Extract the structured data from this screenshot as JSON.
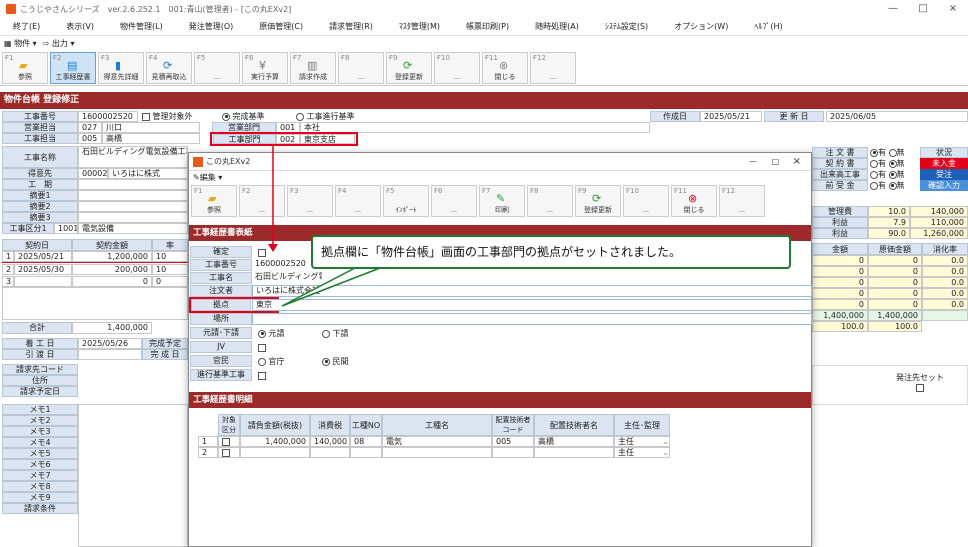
{
  "window": {
    "title": "こうじやさんシリーズ　ver.2.6.252.1　001:青山(管理者) - [この丸EXv2]",
    "minimize": "—",
    "maximize": "□",
    "close": "×"
  },
  "menu": [
    "終了(E)",
    "表示(V)",
    "物件管理(L)",
    "発注管理(O)",
    "原価管理(C)",
    "請求管理(R)",
    "ﾏｽﾀ管理(M)",
    "帳票印刷(P)",
    "随時処理(A)",
    "ｼｽﾃﾑ設定(S)",
    "オプション(W)",
    "ﾍﾙﾌﾟ(H)"
  ],
  "subbar": {
    "item1": "物件",
    "item2": "出力"
  },
  "fkeys": [
    {
      "key": "F1",
      "label": "参照",
      "icon": "folder-icon"
    },
    {
      "key": "F2",
      "label": "工事経歴書",
      "icon": "document-icon"
    },
    {
      "key": "F3",
      "label": "得意先詳細",
      "icon": "user-icon"
    },
    {
      "key": "F4",
      "label": "見積再取込",
      "icon": "refresh-icon"
    },
    {
      "key": "F5",
      "label": "—",
      "icon": ""
    },
    {
      "key": "F6",
      "label": "実行予算",
      "icon": "yen-icon"
    },
    {
      "key": "F7",
      "label": "請求作成",
      "icon": "doc-icon"
    },
    {
      "key": "F8",
      "label": "—",
      "icon": ""
    },
    {
      "key": "F9",
      "label": "登録更新",
      "icon": "refresh-icon"
    },
    {
      "key": "F10",
      "label": "—",
      "icon": ""
    },
    {
      "key": "F11",
      "label": "閉じる",
      "icon": "close-icon"
    },
    {
      "key": "F12",
      "label": "—",
      "icon": ""
    }
  ],
  "section": {
    "title": "物件台帳 登録修正"
  },
  "form": {
    "koji_no_label": "工事番号",
    "koji_no": "1600002520",
    "kanri_gai": "管理対象外",
    "kanseikijun": "完成基準",
    "shinkou": "工事進行基準",
    "sakuseibi_label": "作成日",
    "sakuseibi": "2025/05/21",
    "koshinbi_label": "更 新 日",
    "koshinbi": "2025/06/05",
    "eigyo_label": "営業担当",
    "eigyo_code": "027",
    "eigyo_name": "川口",
    "eigyobumon_label": "営業部門",
    "eigyobumon_code": "001",
    "eigyobumon_name": "本社",
    "koji_tanto_label": "工事担当",
    "koji_tanto_code": "005",
    "koji_tanto_name": "高橋",
    "kojibumon_label": "工事部門",
    "kojibumon_code": "002",
    "kojibumon_name": "東京支店",
    "kojimei_label": "工事名称",
    "kojimei": "石田ビルディング電気設備工事",
    "tokuisaki_label": "得意先",
    "tokuisaki_code": "00002",
    "tokuisaki_name": "いろはに株式",
    "kouki_label": "工　期",
    "tekiyo1": "摘要1",
    "tekiyo2": "摘要2",
    "tekiyo3": "摘要3",
    "kojikubun_label": "工事区分1",
    "kojikubun_code": "1001",
    "kojikubun_name": "電気設備"
  },
  "contract": {
    "headers": [
      "契約日",
      "契約金額",
      "率"
    ],
    "rows": [
      [
        "1",
        "2025/05/21",
        "1,200,000",
        "10"
      ],
      [
        "2",
        "2025/05/30",
        "200,000",
        "10"
      ],
      [
        "3",
        "",
        "0",
        "0"
      ]
    ],
    "total_label": "合計",
    "total": "1,400,000"
  },
  "dates": {
    "chakko_label": "着 工 日",
    "chakko": "2025/05/26",
    "kansei_label": "完成予定",
    "hikiwatashi_label": "引 渡 日",
    "kansei2_label": "完 成 日"
  },
  "left_memo": {
    "seikyu_code": "請求先コード",
    "jusho": "住所",
    "seikyu_yotei": "請求予定日",
    "memos": [
      "メモ1",
      "メモ2",
      "メモ3",
      "メモ4",
      "メモ5",
      "メモ6",
      "メモ7",
      "メモ8",
      "メモ9"
    ],
    "joken": "請求条件"
  },
  "right": {
    "chumon_label": "注 文 書",
    "keiyaku_label": "契 約 書",
    "dekidaka_label": "出来高工事",
    "maeukekin_label": "前 受 金",
    "yes": "有",
    "no": "無",
    "jokyo_label": "状況",
    "state1": "未入金",
    "state2": "受注",
    "state3": "確認入力",
    "kanrihi_label": "管理費",
    "kanrihi_rate": "10.0",
    "kanrihi_amt": "140,000",
    "rieki1_label": "利益",
    "rieki1_rate": "7.9",
    "rieki1_amt": "110,000",
    "rieki2_label": "利益",
    "rieki2_rate": "90.0",
    "rieki2_amt": "1,260,000",
    "cost_headers": [
      "金額",
      "原価金額",
      "消化率"
    ],
    "cost_rows": [
      [
        "0",
        "0",
        "0.0"
      ],
      [
        "0",
        "0",
        "0.0"
      ],
      [
        "0",
        "0",
        "0.0"
      ],
      [
        "0",
        "0",
        "0.0"
      ],
      [
        "0",
        "0",
        "0.0"
      ]
    ],
    "cost_total": [
      "1,400,000",
      "1,400,000",
      ""
    ],
    "cost_pct": [
      "100.0",
      "100.0",
      ""
    ],
    "hacchusaki_set": "発注先セット"
  },
  "popup": {
    "title": "この丸EXv2",
    "menu": "編集",
    "fkeys": [
      {
        "key": "F1",
        "label": "参照"
      },
      {
        "key": "F2",
        "label": "—"
      },
      {
        "key": "F3",
        "label": "—"
      },
      {
        "key": "F4",
        "label": "—"
      },
      {
        "key": "F5",
        "label": "ｲﾝﾎﾟｰﾄ"
      },
      {
        "key": "F6",
        "label": "—"
      },
      {
        "key": "F7",
        "label": "印刷"
      },
      {
        "key": "F8",
        "label": "—"
      },
      {
        "key": "F9",
        "label": "登録更新"
      },
      {
        "key": "F10",
        "label": "—"
      },
      {
        "key": "F11",
        "label": "閉じる"
      },
      {
        "key": "F12",
        "label": "—"
      }
    ],
    "header": "工事経歴書表紙",
    "kakutei_label": "確定",
    "koji_no_label": "工事番号",
    "koji_no": "1600002520",
    "kojimei_label": "工事名",
    "kojimei": "石田ビルディング電気設備工事",
    "chumonsha_label": "注文者",
    "chumonsha": "いろはに株式会社",
    "kyoten_label": "拠点",
    "kyoten": "東京",
    "basho_label": "場所",
    "motouke_label": "元請･下請",
    "motouke": "元請",
    "shitauke": "下請",
    "jv_label": "JV",
    "kanmin_label": "官民",
    "kancho": "官庁",
    "minkan": "民間",
    "shinko_label": "進行基準工事",
    "detail_header": "工事経歴書明細",
    "table_headers": [
      "対象区分",
      "請負金額(税抜)",
      "消費税",
      "工種NO",
      "工種名",
      "配置技術者コード",
      "配置技術者名",
      "主任･監理"
    ],
    "rows": [
      [
        "1",
        "1,400,000",
        "140,000",
        "08",
        "電気",
        "005",
        "高橋",
        "主任"
      ],
      [
        "2",
        "",
        "",
        "",
        "",
        "",
        "",
        "主任"
      ]
    ]
  },
  "callout": "拠点欄に「物件台帳」画面の工事部門の拠点がセットされました。"
}
